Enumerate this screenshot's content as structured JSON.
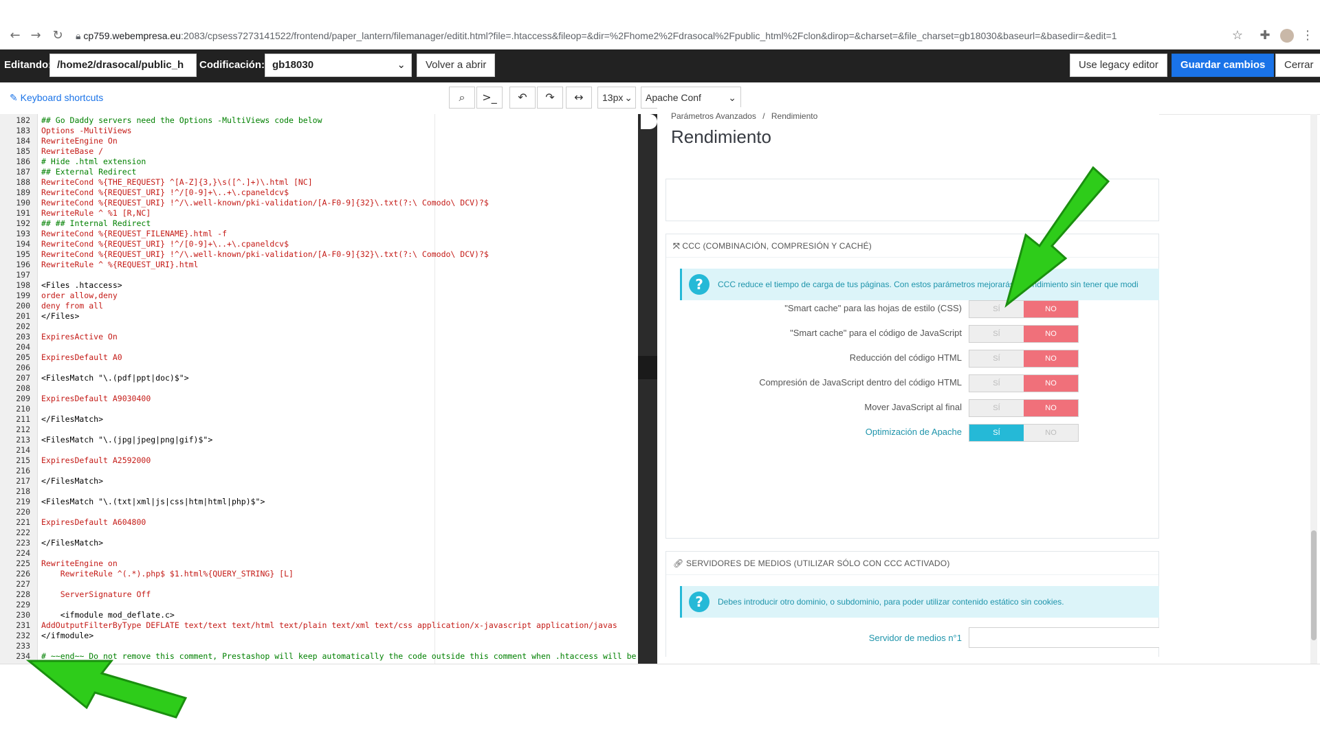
{
  "browser": {
    "url_host": "cp759.webempresa.eu",
    "url_rest": ":2083/cpsess7273141522/frontend/paper_lantern/filemanager/editit.html?file=.htaccess&fileop=&dir=%2Fhome2%2Fdrasocal%2Fpublic_html%2Fclon&dirop=&charset=&file_charset=gb18030&baseurl=&basedir=&edit=1"
  },
  "toolbar": {
    "editing_label": "Editando:",
    "path_value": "/home2/drasocal/public_h",
    "encoding_label": "Codificación:",
    "encoding_value": "gb18030",
    "reopen_button": "Volver a abrir",
    "legacy_button": "Use legacy editor",
    "save_button": "Guardar cambios",
    "close_button": "Cerrar"
  },
  "subbar": {
    "shortcuts_link": "Keyboard shortcuts",
    "font_size": "13px",
    "mode": "Apache Conf"
  },
  "code": [
    {
      "n": "182",
      "t": "## Go Daddy servers need the Options -MultiViews code below"
    },
    {
      "n": "183",
      "t": "Options -MultiViews"
    },
    {
      "n": "184",
      "t": "RewriteEngine On"
    },
    {
      "n": "185",
      "t": "RewriteBase /"
    },
    {
      "n": "186",
      "t": "# Hide .html extension"
    },
    {
      "n": "187",
      "t": "## External Redirect"
    },
    {
      "n": "188",
      "t": "RewriteCond %{THE_REQUEST} ^[A-Z]{3,}\\s([^.]+)\\.html [NC]"
    },
    {
      "n": "189",
      "t": "RewriteCond %{REQUEST_URI} !^/[0-9]+\\..+\\.cpaneldcv$"
    },
    {
      "n": "190",
      "t": "RewriteCond %{REQUEST_URI} !^/\\.well-known/pki-validation/[A-F0-9]{32}\\.txt(?:\\ Comodo\\ DCV)?$"
    },
    {
      "n": "191",
      "t": "RewriteRule ^ %1 [R,NC]"
    },
    {
      "n": "192",
      "t": "## ## Internal Redirect"
    },
    {
      "n": "193",
      "t": "RewriteCond %{REQUEST_FILENAME}.html -f"
    },
    {
      "n": "194",
      "t": "RewriteCond %{REQUEST_URI} !^/[0-9]+\\..+\\.cpaneldcv$"
    },
    {
      "n": "195",
      "t": "RewriteCond %{REQUEST_URI} !^/\\.well-known/pki-validation/[A-F0-9]{32}\\.txt(?:\\ Comodo\\ DCV)?$"
    },
    {
      "n": "196",
      "t": "RewriteRule ^ %{REQUEST_URI}.html"
    },
    {
      "n": "197",
      "t": ""
    },
    {
      "n": "198",
      "t": "<Files .htaccess>"
    },
    {
      "n": "199",
      "t": "order allow,deny"
    },
    {
      "n": "200",
      "t": "deny from all"
    },
    {
      "n": "201",
      "t": "</Files>"
    },
    {
      "n": "202",
      "t": ""
    },
    {
      "n": "203",
      "t": "ExpiresActive On"
    },
    {
      "n": "204",
      "t": ""
    },
    {
      "n": "205",
      "t": "ExpiresDefault A0"
    },
    {
      "n": "206",
      "t": ""
    },
    {
      "n": "207",
      "t": "<FilesMatch \"\\.(pdf|ppt|doc)$\">"
    },
    {
      "n": "208",
      "t": ""
    },
    {
      "n": "209",
      "t": "ExpiresDefault A9030400"
    },
    {
      "n": "210",
      "t": ""
    },
    {
      "n": "211",
      "t": "</FilesMatch>"
    },
    {
      "n": "212",
      "t": ""
    },
    {
      "n": "213",
      "t": "<FilesMatch \"\\.(jpg|jpeg|png|gif)$\">"
    },
    {
      "n": "214",
      "t": ""
    },
    {
      "n": "215",
      "t": "ExpiresDefault A2592000"
    },
    {
      "n": "216",
      "t": ""
    },
    {
      "n": "217",
      "t": "</FilesMatch>"
    },
    {
      "n": "218",
      "t": ""
    },
    {
      "n": "219",
      "t": "<FilesMatch \"\\.(txt|xml|js|css|htm|html|php)$\">"
    },
    {
      "n": "220",
      "t": ""
    },
    {
      "n": "221",
      "t": "ExpiresDefault A604800"
    },
    {
      "n": "222",
      "t": ""
    },
    {
      "n": "223",
      "t": "</FilesMatch>"
    },
    {
      "n": "224",
      "t": ""
    },
    {
      "n": "225",
      "t": "RewriteEngine on"
    },
    {
      "n": "226",
      "t": "    RewriteRule ^(.*).php$ $1.html%{QUERY_STRING} [L]"
    },
    {
      "n": "227",
      "t": ""
    },
    {
      "n": "228",
      "t": "    ServerSignature Off"
    },
    {
      "n": "229",
      "t": ""
    },
    {
      "n": "230",
      "t": "    <ifmodule mod_deflate.c>"
    },
    {
      "n": "231",
      "t": "AddOutputFilterByType DEFLATE text/text text/html text/plain text/xml text/css application/x-javascript application/javas"
    },
    {
      "n": "232",
      "t": "</ifmodule>"
    },
    {
      "n": "233",
      "t": ""
    },
    {
      "n": "234",
      "t": "# ~~end~~ Do not remove this comment, Prestashop will keep automatically the code outside this comment when .htaccess will be generated again"
    }
  ],
  "embedded": {
    "breadcrumb_parent": "Parámetros Avanzados",
    "breadcrumb_sep": "/",
    "breadcrumb_current": "Rendimiento",
    "page_title": "Rendimiento",
    "ccc_panel_title": "CCC (COMBINACIÓN, COMPRESIÓN Y CACHÉ)",
    "ccc_info": "CCC reduce el tiempo de carga de tus páginas. Con estos parámetros mejorarás el rendimiento sin tener que modi",
    "yes_label": "SÍ",
    "no_label": "NO",
    "options": [
      {
        "label": "\"Smart cache\" para las hojas de estilo (CSS)",
        "value": "NO"
      },
      {
        "label": "\"Smart cache\" para el código de JavaScript",
        "value": "NO"
      },
      {
        "label": "Reducción del código HTML",
        "value": "NO"
      },
      {
        "label": "Compresión de JavaScript dentro del código HTML",
        "value": "NO"
      },
      {
        "label": "Mover JavaScript al final",
        "value": "NO"
      },
      {
        "label": "Optimización de Apache",
        "value": "SÍ"
      }
    ],
    "media_panel_title": "SERVIDORES DE MEDIOS (UTILIZAR SÓLO CON CCC ACTIVADO)",
    "media_info": "Debes introducir otro dominio, o subdominio, para poder utilizar contenido estático sin cookies.",
    "media_server_label": "Servidor de medios n°1"
  },
  "colors": {
    "toolbar_bg": "#222222",
    "primary": "#1a73e8",
    "toggle_no": "#f0707a",
    "toggle_yes": "#25b9d7",
    "arrow": "#2ecc1a"
  }
}
